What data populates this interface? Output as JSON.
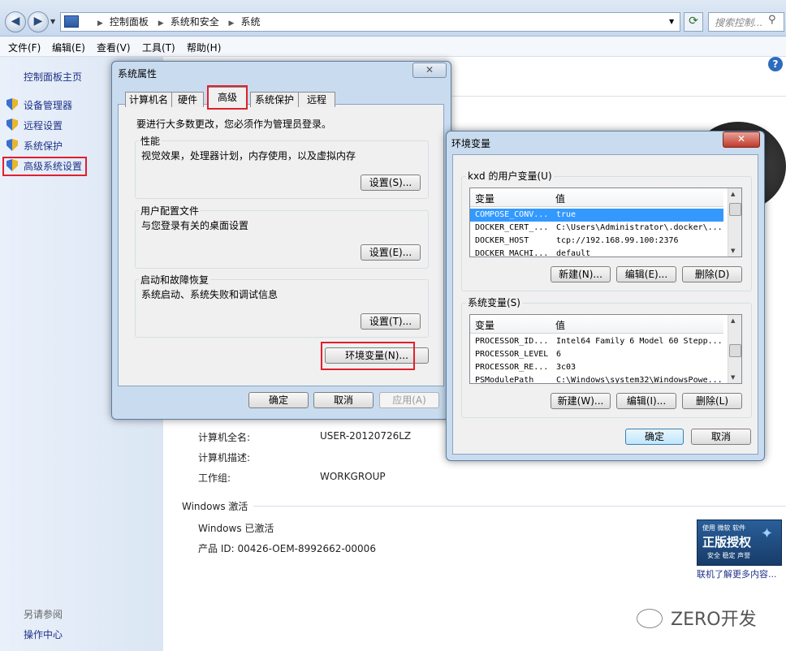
{
  "explorer": {
    "breadcrumb": [
      "控制面板",
      "系统和安全",
      "系统"
    ],
    "search_placeholder": "搜索控制...",
    "menu": [
      "文件(F)",
      "编辑(E)",
      "查看(V)",
      "工具(T)",
      "帮助(H)"
    ]
  },
  "left_nav": {
    "home": "控制面板主页",
    "items": [
      "设备管理器",
      "远程设置",
      "系统保护",
      "高级系统设置"
    ],
    "see_also_title": "另请参阅",
    "see_also": [
      "操作中心"
    ]
  },
  "system_info": {
    "rows": [
      {
        "label": "计算机全名:",
        "value": "USER-20120726LZ"
      },
      {
        "label": "计算机描述:",
        "value": ""
      },
      {
        "label": "工作组:",
        "value": "WORKGROUP"
      }
    ],
    "activation_title": "Windows 激活",
    "activation_status": "Windows 已激活",
    "product_id": "产品 ID: 00426-OEM-8992662-00006",
    "genuine_badge": {
      "top": "使用 微软 软件",
      "main": "正版授权",
      "bottom": "安全 稳定 声誉"
    },
    "genuine_link": "联机了解更多内容..."
  },
  "sys_props": {
    "title": "系统属性",
    "tabs": [
      "计算机名",
      "硬件",
      "高级",
      "系统保护",
      "远程"
    ],
    "active_tab": "高级",
    "admin_note": "要进行大多数更改，您必须作为管理员登录。",
    "groups": [
      {
        "label": "性能",
        "desc": "视觉效果，处理器计划，内存使用，以及虚拟内存",
        "button": "设置(S)..."
      },
      {
        "label": "用户配置文件",
        "desc": "与您登录有关的桌面设置",
        "button": "设置(E)..."
      },
      {
        "label": "启动和故障恢复",
        "desc": "系统启动、系统失败和调试信息",
        "button": "设置(T)..."
      }
    ],
    "env_button": "环境变量(N)...",
    "ok": "确定",
    "cancel": "取消",
    "apply": "应用(A)"
  },
  "env_vars": {
    "title": "环境变量",
    "user_group": "kxd 的用户变量(U)",
    "col_var": "变量",
    "col_val": "值",
    "user_vars": [
      {
        "name": "COMPOSE_CONV...",
        "value": "true",
        "selected": true
      },
      {
        "name": "DOCKER_CERT_...",
        "value": "C:\\Users\\Administrator\\.docker\\..."
      },
      {
        "name": "DOCKER_HOST",
        "value": "tcp://192.168.99.100:2376"
      },
      {
        "name": "DOCKER_MACHI...",
        "value": "default"
      }
    ],
    "user_buttons": [
      "新建(N)...",
      "编辑(E)...",
      "删除(D)"
    ],
    "sys_group": "系统变量(S)",
    "sys_vars": [
      {
        "name": "PROCESSOR_ID...",
        "value": "Intel64 Family 6 Model 60 Stepp..."
      },
      {
        "name": "PROCESSOR_LEVEL",
        "value": "6"
      },
      {
        "name": "PROCESSOR_RE...",
        "value": "3c03"
      },
      {
        "name": "PSModulePath",
        "value": "C:\\Windows\\system32\\WindowsPowe..."
      }
    ],
    "sys_buttons": [
      "新建(W)...",
      "编辑(I)...",
      "删除(L)"
    ],
    "ok": "确定",
    "cancel": "取消"
  },
  "watermark": "ZERO开发"
}
